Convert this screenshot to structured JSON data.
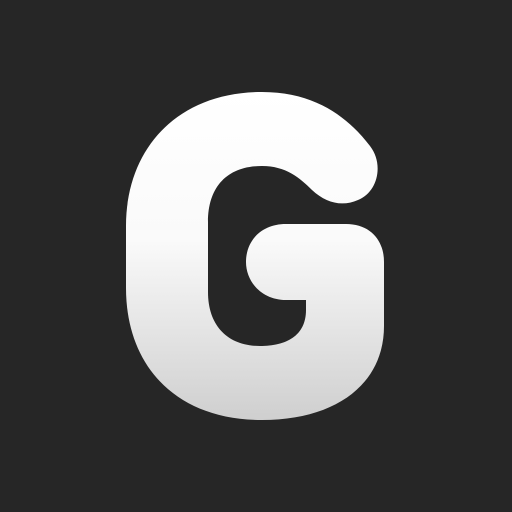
{
  "app_icon": {
    "icon_name": "g-letter-logo-icon",
    "logo_text": "G",
    "colors": {
      "background": "#262626",
      "glyph_top": "#ffffff",
      "glyph_bottom": "#cfcfcf"
    }
  }
}
